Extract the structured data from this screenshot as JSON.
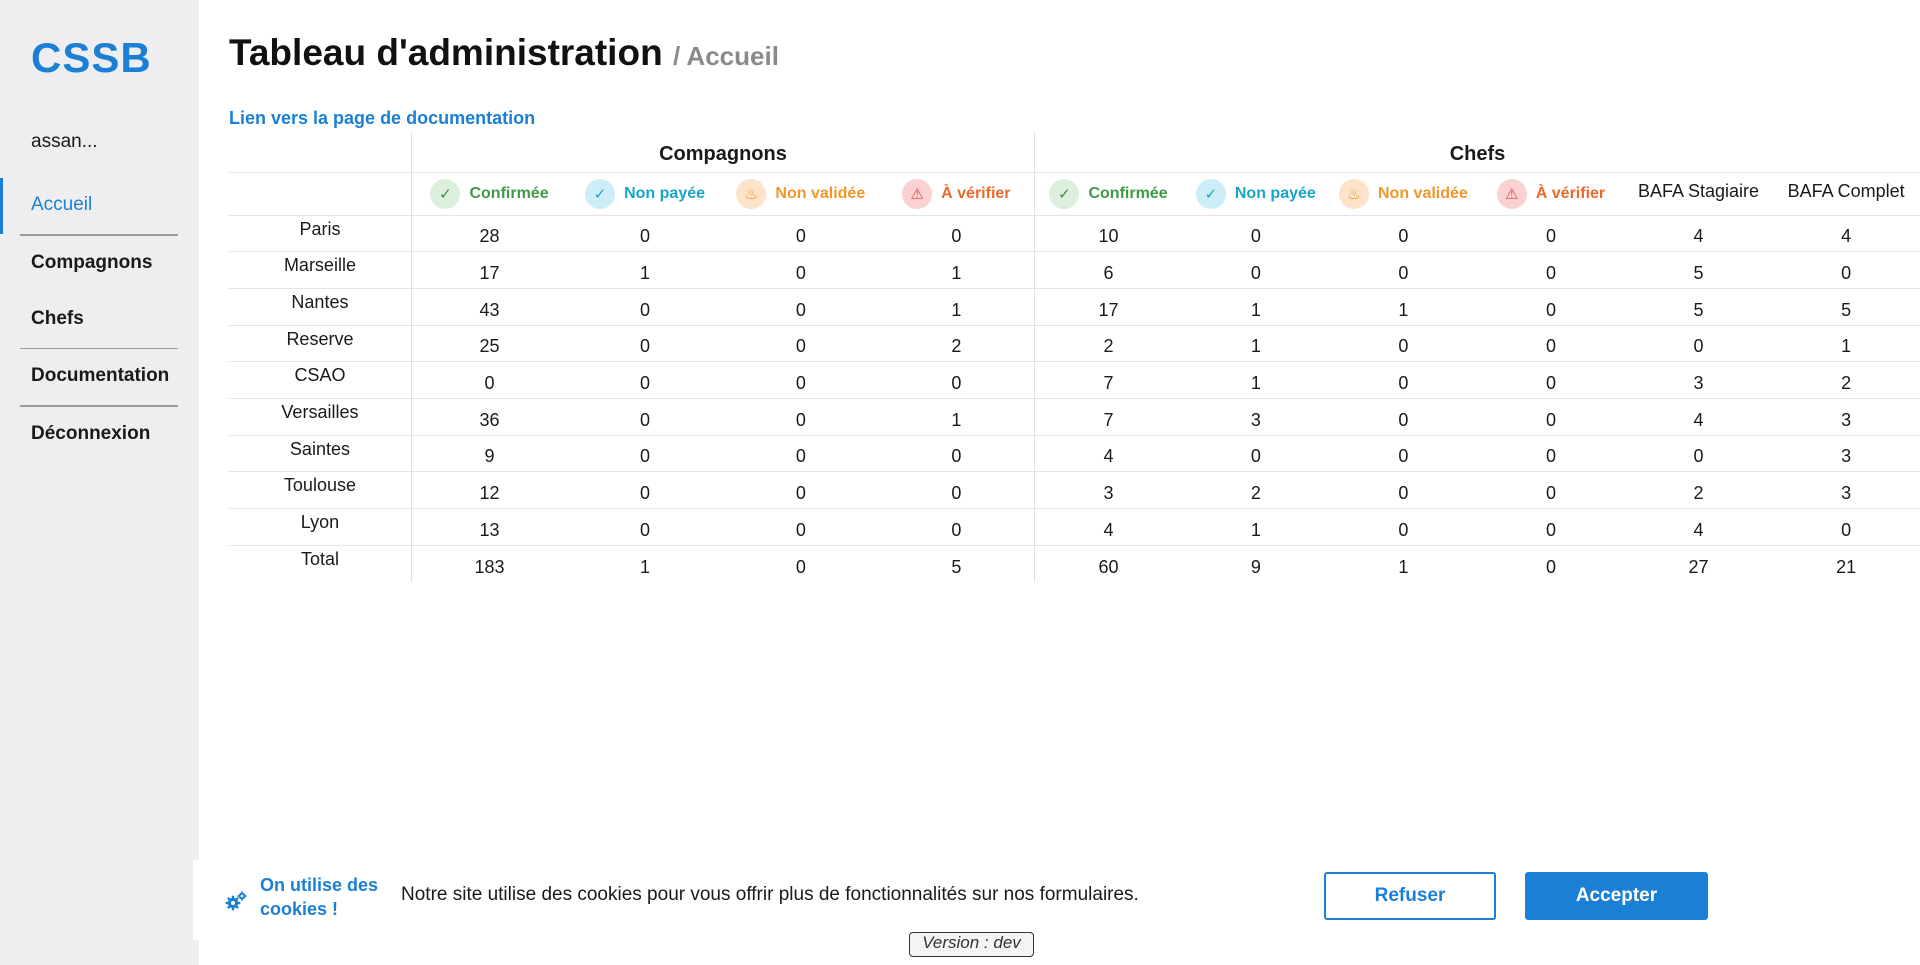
{
  "app": {
    "brand": "CSSB",
    "user": "assan..."
  },
  "sidebar": {
    "items": [
      {
        "label": "Accueil"
      },
      {
        "label": "Compagnons"
      },
      {
        "label": "Chefs"
      },
      {
        "label": "Documentation"
      },
      {
        "label": "Déconnexion"
      }
    ]
  },
  "header": {
    "title": "Tableau d'administration",
    "crumb": "/ Accueil"
  },
  "doc_link": "Lien vers la page de documentation",
  "table": {
    "groups": {
      "compagnons": "Compagnons",
      "chefs": "Chefs"
    },
    "status": {
      "confirmee": "Confirmée",
      "non_payee": "Non payée",
      "non_validee": "Non validée",
      "a_verifier": "À vérifier"
    },
    "bafa_stagiaire": "BAFA Stagiaire",
    "bafa_complet": "BAFA Complet",
    "rows": [
      {
        "city": "Paris",
        "values": [
          "28",
          "0",
          "0",
          "0",
          "10",
          "0",
          "0",
          "0",
          "4",
          "4"
        ]
      },
      {
        "city": "Marseille",
        "values": [
          "17",
          "1",
          "0",
          "1",
          "6",
          "0",
          "0",
          "0",
          "5",
          "0"
        ]
      },
      {
        "city": "Nantes",
        "values": [
          "43",
          "0",
          "0",
          "1",
          "17",
          "1",
          "1",
          "0",
          "5",
          "5"
        ]
      },
      {
        "city": "Reserve",
        "values": [
          "25",
          "0",
          "0",
          "2",
          "2",
          "1",
          "0",
          "0",
          "0",
          "1"
        ]
      },
      {
        "city": "CSAO",
        "values": [
          "0",
          "0",
          "0",
          "0",
          "7",
          "1",
          "0",
          "0",
          "3",
          "2"
        ]
      },
      {
        "city": "Versailles",
        "values": [
          "36",
          "0",
          "0",
          "1",
          "7",
          "3",
          "0",
          "0",
          "4",
          "3"
        ]
      },
      {
        "city": "Saintes",
        "values": [
          "9",
          "0",
          "0",
          "0",
          "4",
          "0",
          "0",
          "0",
          "0",
          "3"
        ]
      },
      {
        "city": "Toulouse",
        "values": [
          "12",
          "0",
          "0",
          "0",
          "3",
          "2",
          "0",
          "0",
          "2",
          "3"
        ]
      },
      {
        "city": "Lyon",
        "values": [
          "13",
          "0",
          "0",
          "0",
          "4",
          "1",
          "0",
          "0",
          "4",
          "0"
        ]
      },
      {
        "city": "Total",
        "values": [
          "183",
          "1",
          "0",
          "5",
          "60",
          "9",
          "1",
          "0",
          "27",
          "21"
        ]
      }
    ]
  },
  "cookie": {
    "icon": "gear-icon",
    "title": "On utilise des cookies !",
    "text": "Notre site utilise des cookies pour vous offrir plus de fonctionnalités sur nos formulaires.",
    "refuse": "Refuser",
    "accept": "Accepter"
  },
  "version": "Version : dev",
  "colors": {
    "accent": "#1b7fd6",
    "confirmed": "#3f9a45",
    "unpaid": "#17a6c8",
    "unvalidated": "#f0962a",
    "to_verify": "#ea6a2e"
  }
}
